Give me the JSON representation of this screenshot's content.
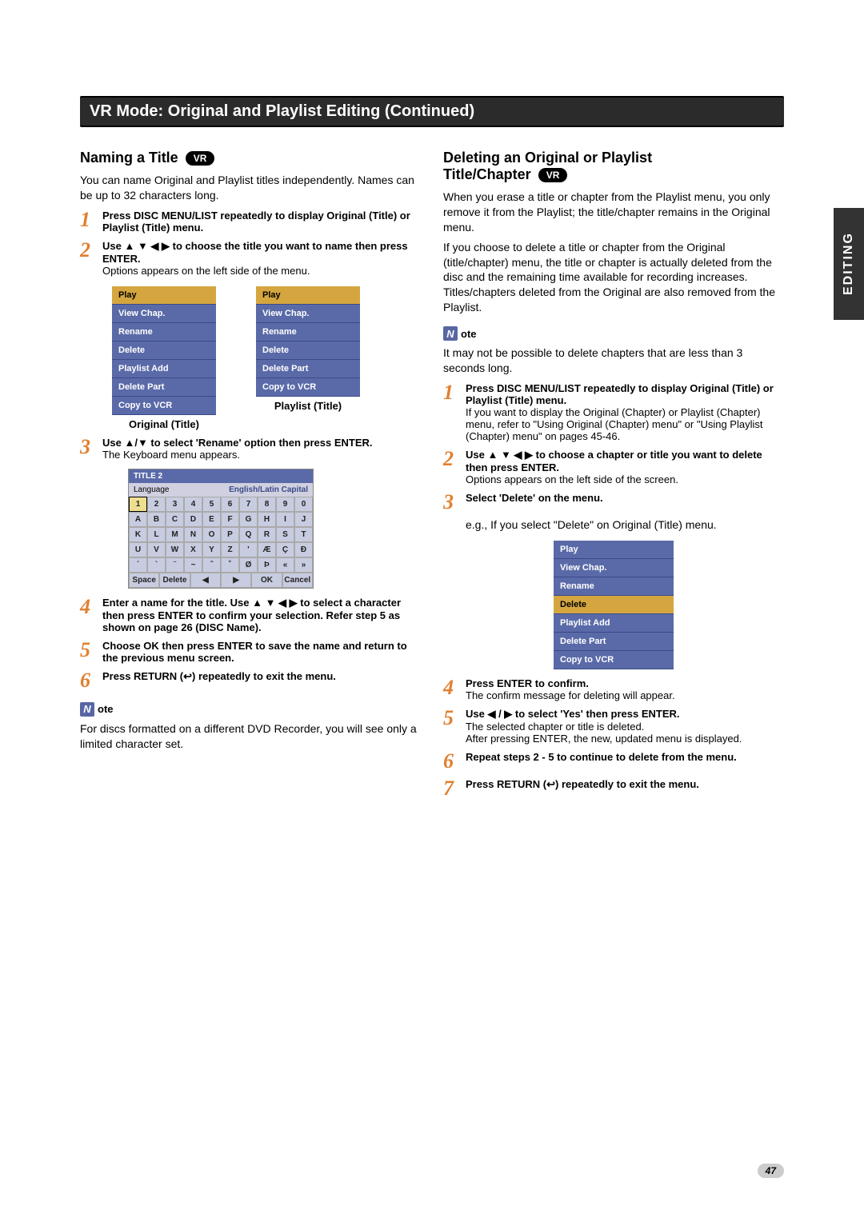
{
  "section_tab": "EDITING",
  "title_bar": "VR Mode: Original and Playlist Editing (Continued)",
  "page_number": "47",
  "left": {
    "heading": "Naming a Title",
    "vr": "VR",
    "intro": "You can name Original and Playlist titles independently. Names can be up to 32 characters long.",
    "step1": "Press DISC MENU/LIST repeatedly to display Original (Title) or Playlist (Title) menu.",
    "step2": "Use ▲ ▼ ◀ ▶ to choose the title you want to name then press ENTER.",
    "step2_sub": "Options appears on the left side of the menu.",
    "menu_original_caption": "Original (Title)",
    "menu_playlist_caption": "Playlist (Title)",
    "menu_orig": [
      "Play",
      "View Chap.",
      "Rename",
      "Delete",
      "Playlist Add",
      "Delete Part",
      "Copy to VCR"
    ],
    "menu_pl": [
      "Play",
      "View Chap.",
      "Rename",
      "Delete",
      "Delete Part",
      "Copy to VCR"
    ],
    "step3": "Use ▲/▼ to select 'Rename' option then press ENTER.",
    "step3_sub": "The Keyboard menu appears.",
    "kb_title": "TITLE 2",
    "kb_lang_label": "Language",
    "kb_lang_value": "English/Latin Capital",
    "kb_rows": [
      [
        "1",
        "2",
        "3",
        "4",
        "5",
        "6",
        "7",
        "8",
        "9",
        "0"
      ],
      [
        "A",
        "B",
        "C",
        "D",
        "E",
        "F",
        "G",
        "H",
        "I",
        "J"
      ],
      [
        "K",
        "L",
        "M",
        "N",
        "O",
        "P",
        "Q",
        "R",
        "S",
        "T"
      ],
      [
        "U",
        "V",
        "W",
        "X",
        "Y",
        "Z",
        "'",
        "Æ",
        "Ç",
        "Ð"
      ],
      [
        "´",
        "`",
        "¨",
        "~",
        "ˆ",
        "˚",
        "Ø",
        "Þ",
        "«",
        "»"
      ]
    ],
    "kb_bottom": [
      "Space",
      "Delete",
      "◀",
      "▶",
      "OK",
      "Cancel"
    ],
    "step4": "Enter a name for the title. Use ▲ ▼ ◀ ▶ to select a character then press ENTER to confirm your selection. Refer step 5 as shown on page 26 (DISC Name).",
    "step5": "Choose OK then press ENTER to save the name and return to the previous menu screen.",
    "step6": "Press RETURN (↩) repeatedly to exit the menu.",
    "note_label": "ote",
    "note_body": "For discs formatted on a different DVD Recorder, you will see only a limited character set."
  },
  "right": {
    "heading1": "Deleting an Original or Playlist",
    "heading2": "Title/Chapter",
    "vr": "VR",
    "para1": "When you erase a title or chapter from the Playlist menu, you only remove it from the Playlist; the title/chapter remains in the Original menu.",
    "para2": "If you choose to delete a title or chapter from the Original (title/chapter) menu, the title or chapter is actually deleted from the disc and the remaining time available for recording increases. Titles/chapters deleted from the Original are also removed from the Playlist.",
    "note_label": "ote",
    "note_body": "It may not be possible to delete chapters that are less than 3 seconds long.",
    "step1a": "Press DISC MENU/LIST repeatedly to display Original (Title) or Playlist (Title) menu.",
    "step1b": "If you want to display the Original (Chapter) or Playlist (Chapter) menu, refer to \"Using Original (Chapter) menu\" or \"Using Playlist (Chapter) menu\" on pages 45-46.",
    "step2a": "Use ▲ ▼ ◀ ▶ to choose a chapter or title you want to delete then press ENTER.",
    "step2b": "Options appears on the left side of the screen.",
    "step3": "Select 'Delete' on the menu.",
    "eg": "e.g., If you select \"Delete\" on Original (Title) menu.",
    "menu": [
      "Play",
      "View Chap.",
      "Rename",
      "Delete",
      "Playlist Add",
      "Delete Part",
      "Copy to VCR"
    ],
    "menu_highlight": "Delete",
    "step4a": "Press ENTER to confirm.",
    "step4b": "The confirm message for deleting will appear.",
    "step5a": "Use ◀ / ▶ to select 'Yes' then press ENTER.",
    "step5b": "The selected chapter or title is deleted.",
    "step5c": "After pressing ENTER, the new, updated menu is displayed.",
    "step6": "Repeat steps 2 - 5 to continue to delete from the menu.",
    "step7": "Press RETURN (↩) repeatedly to exit the menu."
  }
}
